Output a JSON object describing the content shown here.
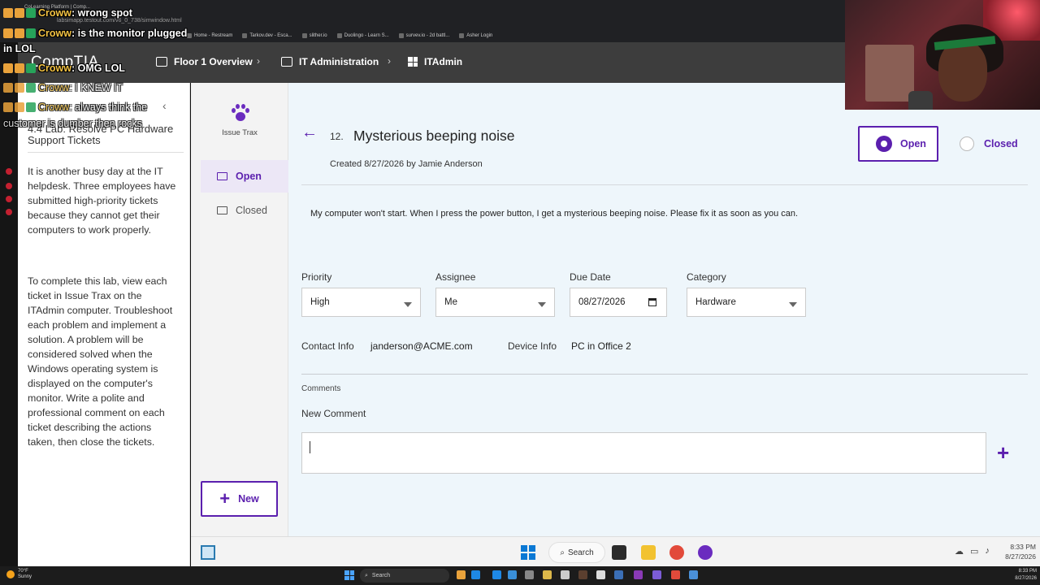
{
  "browser": {
    "tab_title": "CoLearning Platform | Comp...",
    "url": "labsimapp.testout.com/v6_0_738/simwindow.html",
    "bookmarks": [
      "Home - Restream",
      "Tarkov.dev - Esca...",
      "slither.io",
      "Duolingo - Learn S...",
      "survev.io - 2d battl...",
      "Asher Login"
    ]
  },
  "app": {
    "logo": "CompTIA",
    "breadcrumbs": [
      "Floor 1 Overview",
      "IT Administration",
      "ITAdmin"
    ]
  },
  "instructions": {
    "title": "4.4 Lab: Resolve PC Hardware Support Tickets",
    "para1": "It is another busy day at the IT helpdesk. Three employees have submitted high-priority tickets because they cannot get their computers to work properly.",
    "para2": "To complete this lab, view each ticket in Issue Trax on the ITAdmin computer. Troubleshoot each problem and implement a solution. A problem will be considered solved when the Windows operating system is displayed on the computer's monitor. Write a polite and professional comment on each ticket describing the actions taken, then close the tickets."
  },
  "issue_trax": {
    "app_name": "Issue Trax",
    "nav_open": "Open",
    "nav_closed": "Closed",
    "new_button": "New"
  },
  "ticket": {
    "number": "12.",
    "title": "Mysterious beeping noise",
    "created": "Created 8/27/2026 by Jamie Anderson",
    "status_open": "Open",
    "status_closed": "Closed",
    "description": "My computer won't start. When I press the power button, I get a mysterious beeping noise. Please fix it as soon as you can.",
    "priority_label": "Priority",
    "priority_value": "High",
    "assignee_label": "Assignee",
    "assignee_value": "Me",
    "due_label": "Due Date",
    "due_value": "08/27/2026",
    "category_label": "Category",
    "category_value": "Hardware",
    "contact_label": "Contact Info",
    "contact_value": "janderson@ACME.com",
    "device_label": "Device Info",
    "device_value": "PC in Office 2",
    "comments_label": "Comments",
    "new_comment_label": "New Comment"
  },
  "vm_taskbar": {
    "search": "Search",
    "time": "8:33 PM",
    "date": "8/27/2026"
  },
  "host_taskbar": {
    "temp": "70°F",
    "weather": "Sunny",
    "search": "Search",
    "time": "8:33 PM",
    "date": "8/27/2026"
  },
  "chat": [
    {
      "user": "Croww",
      "text": ": wrong spot"
    },
    {
      "user": "Croww",
      "text": ": is the monitor plugged"
    },
    {
      "text": "in LOL"
    },
    {
      "user": "Croww",
      "text": ": OMG LOL"
    },
    {
      "user": "Croww",
      "text": ": I KNEW IT"
    },
    {
      "user": "Croww",
      "text": ": always think the"
    },
    {
      "text": "customer is dumber then rocks"
    }
  ],
  "colors": {
    "accent": "#5b1fae",
    "header_bg": "#3d3d3d",
    "main_bg": "#eef6fb",
    "nav_bg": "#f3f3f3"
  }
}
